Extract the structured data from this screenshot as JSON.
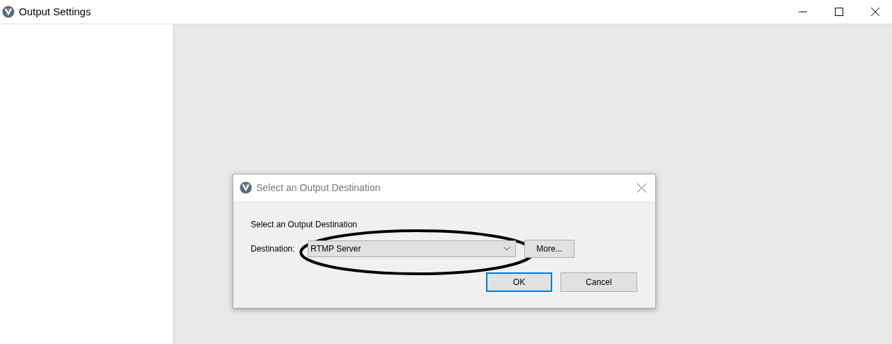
{
  "window": {
    "title": "Output Settings"
  },
  "dialog": {
    "title": "Select an Output Destination",
    "heading": "Select an Output Destination",
    "destination_label": "Destination:",
    "destination": {
      "value": "RTMP Server"
    },
    "more_button": "More...",
    "buttons": [
      {
        "label": "OK",
        "default": true
      },
      {
        "label": "Cancel",
        "default": false
      }
    ]
  }
}
